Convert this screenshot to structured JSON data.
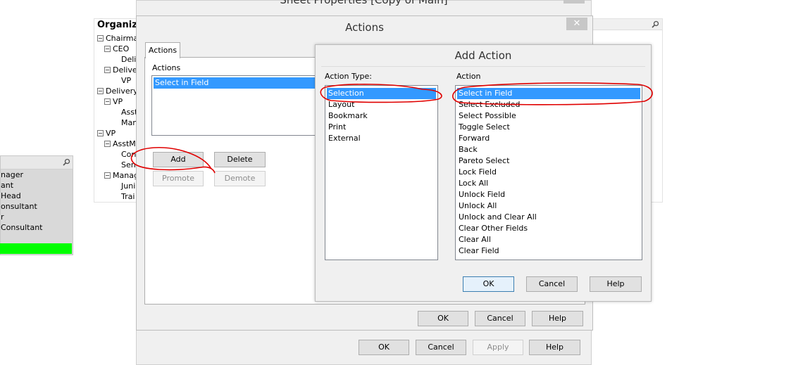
{
  "background": {
    "sheet_properties_title": "Sheet Properties [Copy of Main]",
    "sheet_buttons": {
      "ok": "OK",
      "cancel": "Cancel",
      "apply": "Apply",
      "help": "Help"
    },
    "org_tree": {
      "title": "Organiza",
      "nodes": [
        {
          "label": "Chairman",
          "toggle": "⊟"
        },
        {
          "label": "CEO",
          "toggle": "⊟"
        },
        {
          "label": "Deliv",
          "toggle": ""
        },
        {
          "label": "Deliver",
          "toggle": "⊟"
        },
        {
          "label": "VP",
          "toggle": ""
        },
        {
          "label": "DeliveryH",
          "toggle": "⊟"
        },
        {
          "label": "VP",
          "toggle": "⊟"
        },
        {
          "label": "Asst",
          "toggle": ""
        },
        {
          "label": "Man",
          "toggle": ""
        },
        {
          "label": "VP",
          "toggle": "⊟"
        },
        {
          "label": "AsstMa",
          "toggle": "⊟"
        },
        {
          "label": "Con",
          "toggle": ""
        },
        {
          "label": "Sen",
          "toggle": ""
        },
        {
          "label": "Manag",
          "toggle": "⊟"
        },
        {
          "label": "Juni",
          "toggle": ""
        },
        {
          "label": "Trai",
          "toggle": ""
        }
      ]
    },
    "left_list": [
      "nager",
      "ant",
      "Head",
      "onsultant",
      "r",
      "Consultant"
    ]
  },
  "actions_dialog": {
    "title": "Actions",
    "close_glyph": "✕",
    "tab": "Actions",
    "list_label": "Actions",
    "list_items": [
      "Select in Field"
    ],
    "buttons": {
      "add": "Add",
      "delete": "Delete",
      "promote": "Promote",
      "demote": "Demote",
      "ok": "OK",
      "cancel": "Cancel",
      "help": "Help"
    }
  },
  "add_action_dialog": {
    "title": "Add Action",
    "action_type_label": "Action Type:",
    "action_label": "Action",
    "action_types": [
      "Selection",
      "Layout",
      "Bookmark",
      "Print",
      "External"
    ],
    "actions": [
      "Select in Field",
      "Select Excluded",
      "Select Possible",
      "Toggle Select",
      "Forward",
      "Back",
      "Pareto Select",
      "Lock Field",
      "Lock All",
      "Unlock Field",
      "Unlock All",
      "Unlock and Clear All",
      "Clear Other Fields",
      "Clear All",
      "Clear Field"
    ],
    "buttons": {
      "ok": "OK",
      "cancel": "Cancel",
      "help": "Help"
    }
  },
  "colors": {
    "selection": "#3399ff",
    "annotation": "#e00000",
    "green_bar": "#00ff00"
  },
  "icons": {
    "search": "search-icon",
    "close": "close-icon"
  }
}
